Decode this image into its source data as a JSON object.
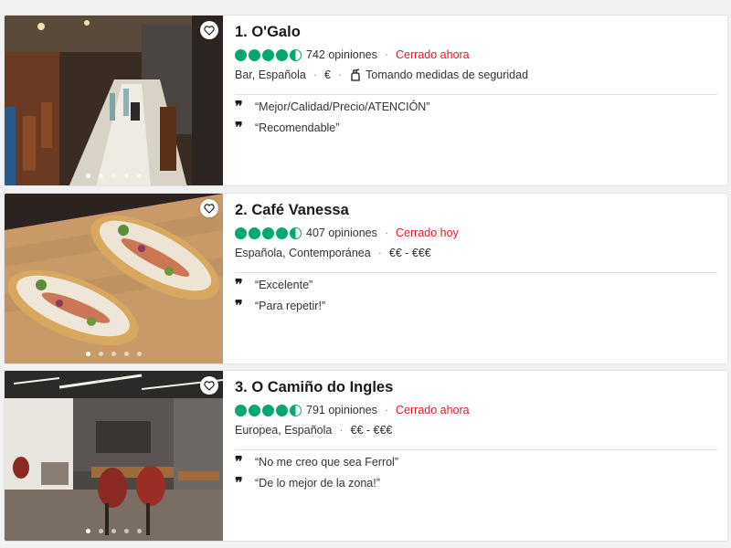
{
  "restaurants": [
    {
      "title": "1. O'Galo",
      "rating": 4.5,
      "reviews": "742 opiniones",
      "status": "Cerrado ahora",
      "cuisine": "Bar, Española",
      "price": "€",
      "safety": "Tomando medidas de seguridad",
      "quotes": [
        "“Mejor/Calidad/Precio/ATENCIÓN”",
        "“Recomendable”"
      ],
      "photo_count": 5,
      "active_photo": 0
    },
    {
      "title": "2. Café Vanessa",
      "rating": 4.5,
      "reviews": "407 opiniones",
      "status": "Cerrado hoy",
      "cuisine": "Española, Contemporánea",
      "price": "€€ - €€€",
      "quotes": [
        "“Excelente”",
        "“Para repetir!”"
      ],
      "photo_count": 5,
      "active_photo": 0
    },
    {
      "title": "3. O Camiño do Ingles",
      "rating": 4.5,
      "reviews": "791 opiniones",
      "status": "Cerrado ahora",
      "cuisine": "Europea, Española",
      "price": "€€ - €€€",
      "quotes": [
        "“No me creo que sea Ferrol”",
        "“De lo mejor de la zona!”"
      ],
      "photo_count": 5,
      "active_photo": 0
    }
  ],
  "icons": {
    "save": "heart-icon",
    "safety": "hand-sanitizer-icon",
    "quote": "quote-icon",
    "rating": "rating-bubble-icon"
  },
  "colors": {
    "rating_green": "#00aa6c",
    "closed_red": "#e21b23"
  }
}
